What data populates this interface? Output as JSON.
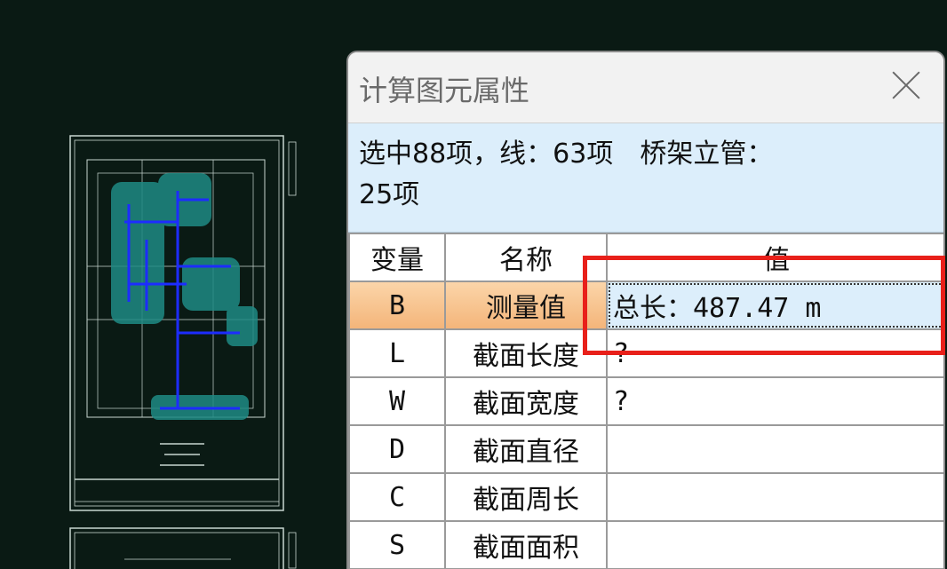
{
  "dialog": {
    "title": "计算图元属性",
    "summary_line1": "选中88项，线：63项　桥架立管：",
    "summary_line2": "25项"
  },
  "table": {
    "headers": [
      "变量",
      "名称",
      "值"
    ],
    "rows": [
      {
        "var": "B",
        "name": "测量值",
        "value": "总长：487.47 m",
        "selected": true
      },
      {
        "var": "L",
        "name": "截面长度",
        "value": "?"
      },
      {
        "var": "W",
        "name": "截面宽度",
        "value": "?"
      },
      {
        "var": "D",
        "name": "截面直径",
        "value": ""
      },
      {
        "var": "C",
        "name": "截面周长",
        "value": ""
      },
      {
        "var": "S",
        "name": "截面面积",
        "value": ""
      }
    ]
  },
  "colors": {
    "background": "#0a1a14",
    "highlight": "#e8201a",
    "selected_row": "#f4b57a",
    "summary_bg": "#dceefb"
  }
}
